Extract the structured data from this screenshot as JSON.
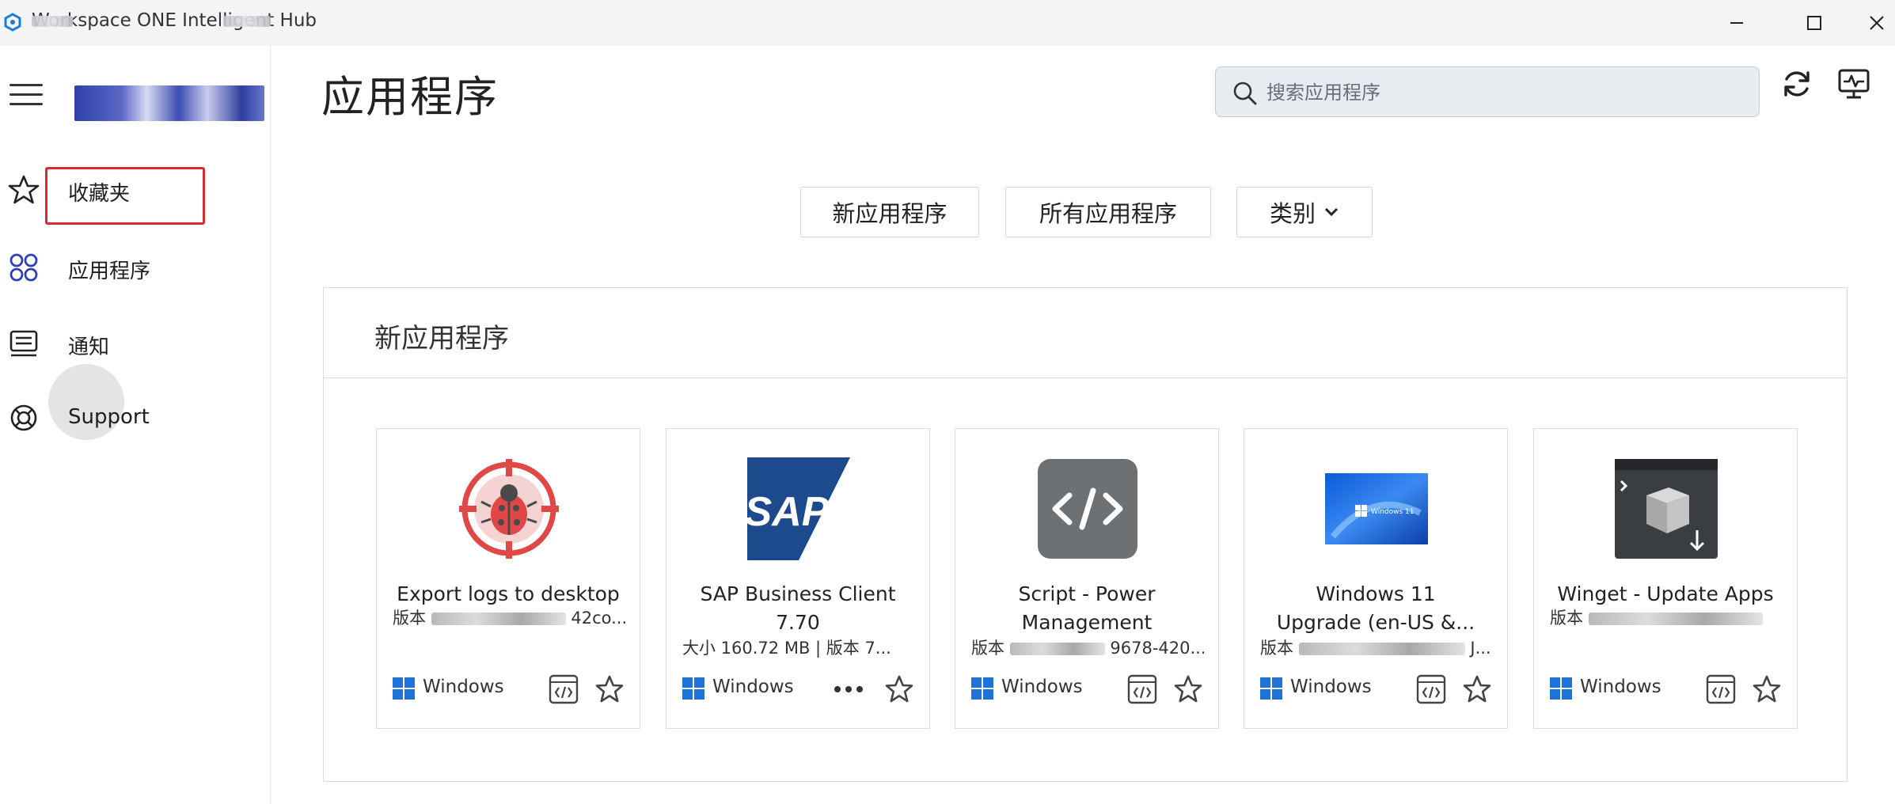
{
  "window": {
    "title": "Workspace ONE Intelligent Hub",
    "minimize_glyph": "—",
    "maximize_glyph": "☐",
    "close_glyph": "✕"
  },
  "sidebar": {
    "items": [
      {
        "label": "收藏夹",
        "icon": "star-icon"
      },
      {
        "label": "应用程序",
        "icon": "apps-icon",
        "selected": true
      },
      {
        "label": "通知",
        "icon": "notifications-icon"
      },
      {
        "label": "Support",
        "icon": "lifebuoy-icon"
      }
    ]
  },
  "header": {
    "title": "应用程序",
    "search_placeholder": "搜索应用程序"
  },
  "filters": {
    "new_apps": "新应用程序",
    "all_apps": "所有应用程序",
    "category": "类别"
  },
  "section": {
    "title": "新应用程序"
  },
  "cards": [
    {
      "name": "Export logs to desktop",
      "meta_prefix": "版本",
      "meta_tail": "42co...",
      "platform": "Windows",
      "icon": "bug-target-icon"
    },
    {
      "name_line1": "SAP Business Client",
      "name_line2": "7.70",
      "meta": "大小 160.72 MB | 版本 7...",
      "platform": "Windows",
      "icon": "sap-logo"
    },
    {
      "name_line1": "Script - Power",
      "name_line2": "Management",
      "meta_prefix": "版本",
      "meta_tail": "9678-420...",
      "platform": "Windows",
      "icon": "code-icon"
    },
    {
      "name_line1": "Windows 11",
      "name_line2": "Upgrade (en-US &...",
      "meta_prefix": "版本",
      "meta_tail": "J...",
      "platform": "Windows",
      "icon": "windows11-thumbnail"
    },
    {
      "name": "Winget - Update Apps",
      "meta_prefix": "版本",
      "meta_tail": "",
      "platform": "Windows",
      "icon": "package-install-icon"
    }
  ]
}
